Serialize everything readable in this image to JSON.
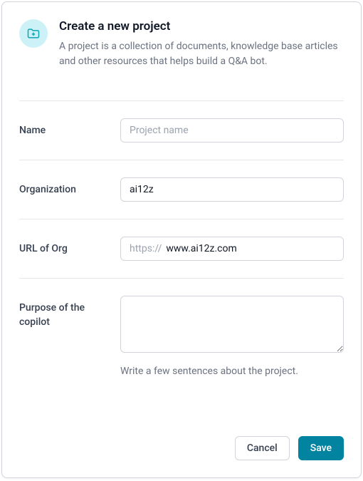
{
  "header": {
    "title": "Create a new project",
    "subtitle": "A project is a collection of documents, knowledge base articles and other resources that helps build a Q&A bot."
  },
  "fields": {
    "name": {
      "label": "Name",
      "placeholder": "Project name",
      "value": ""
    },
    "organization": {
      "label": "Organization",
      "value": "ai12z"
    },
    "url": {
      "label": "URL of Org",
      "prefix": "https://",
      "value": "www.ai12z.com"
    },
    "purpose": {
      "label": "Purpose of the copilot",
      "value": "",
      "help": "Write a few sentences about the project."
    }
  },
  "actions": {
    "cancel": "Cancel",
    "save": "Save"
  }
}
